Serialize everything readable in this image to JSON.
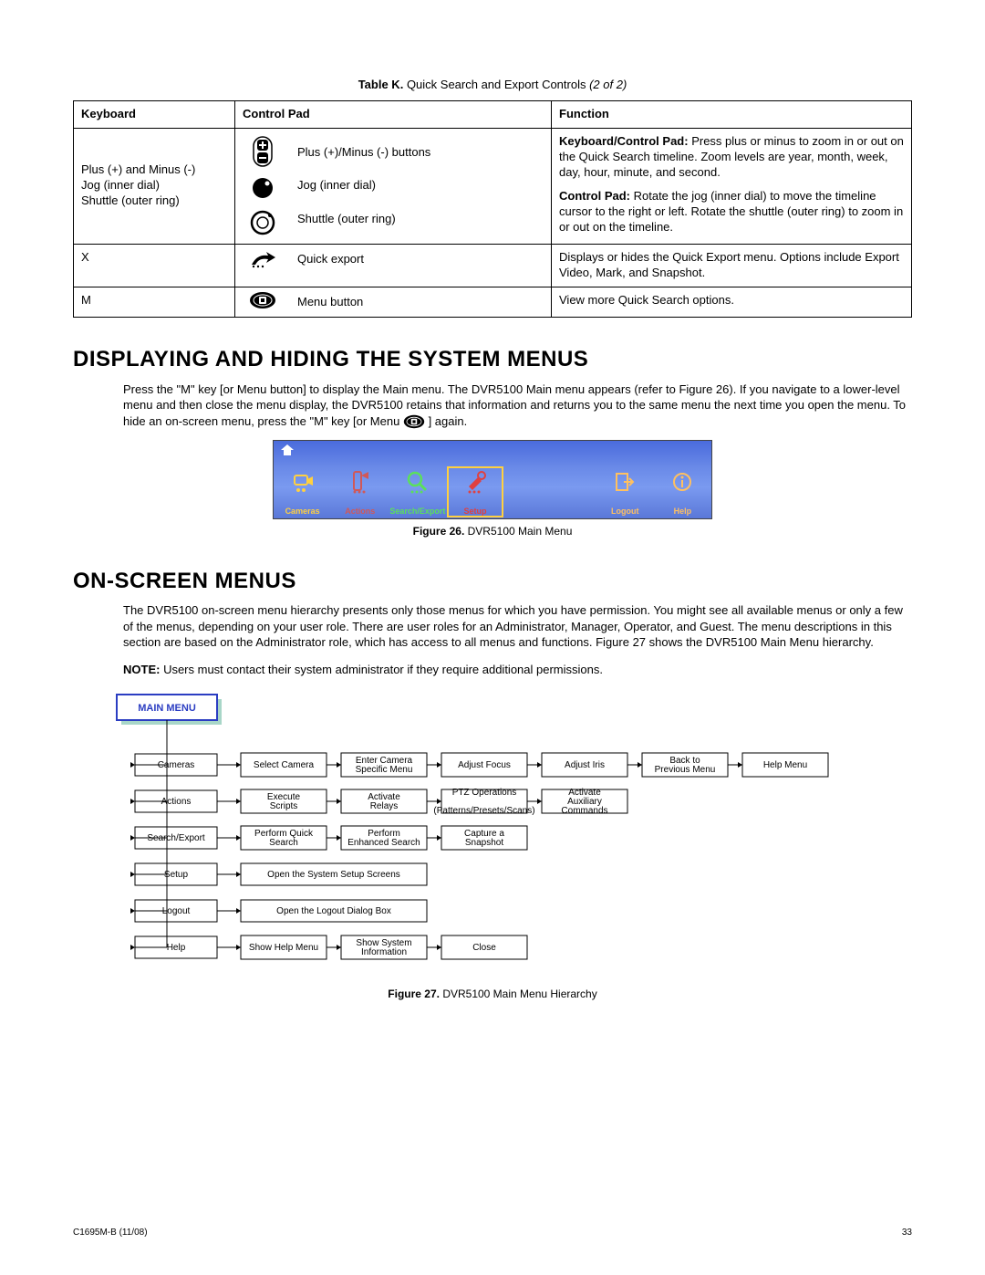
{
  "tableCaption": {
    "label": "Table K.",
    "title": "Quick Search and Export Controls ",
    "part": "(2 of 2)"
  },
  "headers": {
    "keyboard": "Keyboard",
    "controlPad": "Control Pad",
    "function": "Function"
  },
  "row1": {
    "keyboard": "Plus (+) and Minus (-)\nJog (inner dial)\nShuttle (outer ring)",
    "cpLabels": {
      "a": "Plus (+)/Minus (-) buttons",
      "b": "Jog (inner dial)",
      "c": "Shuttle (outer ring)"
    },
    "func": {
      "kbLabel": "Keyboard/Control Pad:",
      "kbText": " Press plus or minus to zoom in or out on the Quick Search timeline. Zoom levels are year, month, week, day, hour, minute, and second.",
      "cpLabel": "Control Pad:",
      "cpText": " Rotate the jog (inner dial) to move the timeline cursor to the right or left. Rotate the shuttle (outer ring) to zoom in or out on the timeline."
    }
  },
  "row2": {
    "keyboard": "X",
    "cpLabel": "Quick export",
    "func": "Displays or hides the Quick Export menu. Options include Export Video, Mark, and Snapshot."
  },
  "row3": {
    "keyboard": "M",
    "cpLabel": "Menu button",
    "func": "View more Quick Search options."
  },
  "section1": {
    "title": "DISPLAYING AND HIDING THE SYSTEM MENUS",
    "p1a": "Press the \"M\" key [or Menu button] to display the Main menu. The DVR5100 Main menu appears (refer to Figure 26). If you navigate to a lower-level menu and then close the menu display, the DVR5100 retains that information and returns you to the same menu the next time you open the menu. To hide an on-screen menu, press the \"M\" key [or Menu ",
    "p1b": " ] again."
  },
  "menuStrip": {
    "items": [
      {
        "label": "Cameras",
        "color": "#ffd040"
      },
      {
        "label": "Actions",
        "color": "#d05858"
      },
      {
        "label": "Search/Export",
        "color": "#5be05b"
      },
      {
        "label": "Setup",
        "color": "#e04040",
        "selected": true
      }
    ],
    "right": [
      {
        "label": "Logout",
        "color": "#ffc060"
      },
      {
        "label": "Help",
        "color": "#ffc060"
      }
    ]
  },
  "fig26": {
    "label": "Figure 26.",
    "title": "DVR5100 Main Menu"
  },
  "section2": {
    "title": "ON-SCREEN MENUS",
    "p1": "The DVR5100 on-screen menu hierarchy presents only those menus for which you have permission. You might see all available menus or only a few of the menus, depending on your user role. There are user roles for an Administrator, Manager, Operator, and Guest. The menu descriptions in this section are based on the Administrator role, which has access to all menus and functions. Figure 27 shows the DVR5100 Main Menu hierarchy.",
    "noteLabel": "NOTE:",
    "noteText": "  Users must contact their system administrator if they require additional permissions."
  },
  "hierarchy": {
    "main": "MAIN MENU",
    "rows": [
      {
        "root": "Cameras",
        "children": [
          "Select Camera",
          "Enter Camera Specific Menu",
          "Adjust Focus",
          "Adjust Iris",
          "Back to Previous Menu",
          "Help Menu"
        ]
      },
      {
        "root": "Actions",
        "children": [
          "Execute Scripts",
          "Activate Relays",
          "PTZ Operations (Patterns/Presets/Scans)",
          "Activate Auxiliary Commands"
        ]
      },
      {
        "root": "Search/Export",
        "children": [
          "Perform Quick Search",
          "Perform Enhanced Search",
          "Capture a Snapshot"
        ]
      },
      {
        "root": "Setup",
        "wide": "Open the System Setup Screens"
      },
      {
        "root": "Logout",
        "wide": "Open the Logout Dialog Box"
      },
      {
        "root": "Help",
        "children": [
          "Show Help Menu",
          "Show System Information",
          "Close"
        ]
      }
    ]
  },
  "fig27": {
    "label": "Figure 27.",
    "title": "DVR5100 Main Menu Hierarchy"
  },
  "footer": {
    "left": "C1695M-B  (11/08)",
    "right": "33"
  }
}
